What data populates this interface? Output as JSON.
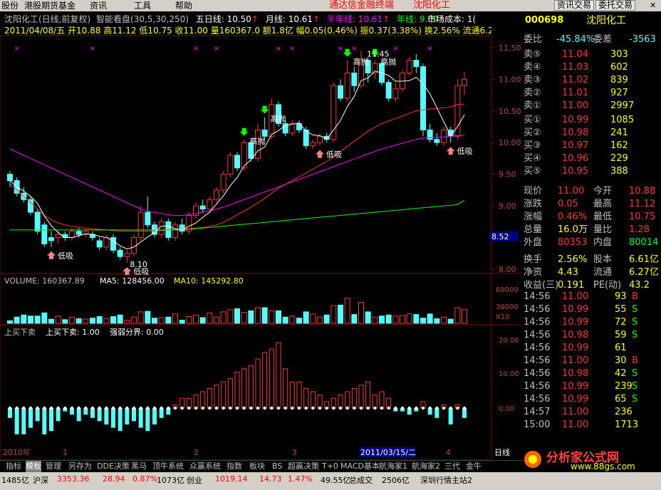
{
  "menubar": {
    "items": [
      "股份",
      "港股期货基金",
      "资讯",
      "工具",
      "帮助"
    ],
    "title": "通达信金融终端",
    "stock_name": "沈阳化工",
    "buttons": [
      "资讯交易",
      "委托交易"
    ]
  },
  "header": {
    "line1": {
      "name": "沈阳化工(日线,前复权)",
      "indicator": "智能看盘(30,5,30,250)",
      "ma5": "五日线: 10.50",
      "ma_month": "月线: 10.61",
      "ma_half": "半年线: 10.61",
      "ma_year": "年线: 9.09",
      "cost": "市场成本: 1("
    },
    "line2": "2011/04/08/五 开10.88 高11.12 低10.75 收11.00 量160367.0 额1.8亿 幅0.05(0.46%) 振0.37(3.38%) 换2.56% 流通6.27亿"
  },
  "price_axis": {
    "ticks": [
      "11.50",
      "11.00",
      "10.50",
      "10.00",
      "9.50",
      "9.00",
      "8.52",
      "8.00"
    ]
  },
  "annotations": {
    "high_sell": "高抛",
    "low_buy": "低吸",
    "peak": "11.45",
    "trough": "8.10"
  },
  "volume": {
    "label": "VOLUME: 160367.89",
    "ma5": "MA5: 128456.00",
    "ma10": "MA10: 145292.80",
    "axis": [
      "60000",
      "30000",
      "X10"
    ]
  },
  "oscillator": {
    "title": "上买下卖",
    "value": "上买下卖: 1.00",
    "boundary": "强弱分界: 0.00",
    "axis": [
      "20.00",
      "10.00",
      "0.00"
    ]
  },
  "date_axis": {
    "labels": [
      "2010年",
      "1",
      "2",
      "3",
      "2011/03/15/二",
      "4",
      "日线"
    ]
  },
  "quote": {
    "code": "000698",
    "name": "沈阳化工",
    "wei": {
      "label": "委比",
      "pct": "-45.84%",
      "diff_label": "委差",
      "diff": "-3563"
    },
    "sells": [
      {
        "l": "卖⑤",
        "p": "11.04",
        "v": "303"
      },
      {
        "l": "卖④",
        "p": "11.03",
        "v": "602"
      },
      {
        "l": "卖③",
        "p": "11.02",
        "v": "839"
      },
      {
        "l": "卖②",
        "p": "11.01",
        "v": "927"
      },
      {
        "l": "卖①",
        "p": "11.00",
        "v": "2997"
      }
    ],
    "buys": [
      {
        "l": "买①",
        "p": "10.99",
        "v": "1085"
      },
      {
        "l": "买②",
        "p": "10.98",
        "v": "241"
      },
      {
        "l": "买③",
        "p": "10.97",
        "v": "162"
      },
      {
        "l": "买④",
        "p": "10.96",
        "v": "229"
      },
      {
        "l": "买⑤",
        "p": "10.95",
        "v": "388"
      }
    ],
    "stats": [
      [
        "现价",
        "11.00",
        "今开",
        "10.88"
      ],
      [
        "涨跌",
        "0.05",
        "最高",
        "11.12"
      ],
      [
        "涨幅",
        "0.46%",
        "最低",
        "10.75"
      ],
      [
        "总量",
        "16.0万",
        "量比",
        "1.28"
      ],
      [
        "外盘",
        "80353",
        "内盘",
        "80014"
      ],
      [
        "换手",
        "2.56%",
        "股本",
        "6.61亿"
      ],
      [
        "净资",
        "4.43",
        "流通",
        "6.27亿"
      ],
      [
        "收益(三)",
        "0.191",
        "PE(动)",
        "43.2"
      ]
    ],
    "ticks": [
      [
        "14:56",
        "11.00",
        "93",
        "B"
      ],
      [
        "14:56",
        "10.99",
        "55",
        "S"
      ],
      [
        "14:56",
        "10.99",
        "72",
        "S"
      ],
      [
        "14:56",
        "10.98",
        "59",
        "S"
      ],
      [
        "14:56",
        "10.99",
        "61",
        ""
      ],
      [
        "14:56",
        "11.00",
        "30",
        "B"
      ],
      [
        "14:56",
        "10.98",
        "42",
        "S"
      ],
      [
        "14:56",
        "10.99",
        "239",
        "S"
      ],
      [
        "14:56",
        "10.99",
        "65",
        "S"
      ],
      [
        "14:57",
        "11.00",
        "236",
        ""
      ],
      [
        "15:00",
        "11.00",
        "1713",
        ""
      ]
    ]
  },
  "tabs": [
    "指标",
    "模板",
    "管理",
    "另存为",
    "DDE决策",
    "黑马",
    "顶牛系统",
    "众赢系统",
    "指数",
    "板块",
    "BS",
    "超赢决策",
    "T+0",
    "MACD基本",
    "航海家1",
    "航海家2",
    "三代",
    "金牛"
  ],
  "statusbar": {
    "items": [
      "1485亿",
      "沪深",
      "3353.36",
      "28.94",
      "0.87%",
      "1073亿",
      "创业",
      "1019.14",
      "14.73",
      "1.47%",
      "49.55亿",
      "总成交",
      "2506亿",
      "深圳行情主站2"
    ]
  },
  "watermark": {
    "text": "分析家公式网",
    "url": "www.88gs.com"
  },
  "colors": {
    "up": "#ff3232",
    "down": "#54fcfc",
    "ma5": "#ffffff",
    "ma_month": "#ff00ff",
    "ma_half": "#ff3232",
    "ma_year": "#00ff00",
    "yellow": "#ffff00"
  },
  "chart_data": {
    "type": "candlestick",
    "ylim": [
      8.0,
      11.6
    ],
    "candles": [
      [
        9.5,
        9.4,
        9.55,
        9.3
      ],
      [
        9.4,
        9.2,
        9.45,
        9.15
      ],
      [
        9.2,
        9.1,
        9.3,
        9.05
      ],
      [
        9.1,
        8.9,
        9.15,
        8.85
      ],
      [
        8.9,
        8.6,
        8.95,
        8.55
      ],
      [
        8.7,
        8.4,
        8.75,
        8.35
      ],
      [
        8.5,
        8.45,
        8.6,
        8.35
      ],
      [
        8.5,
        8.55,
        8.6,
        8.4
      ],
      [
        8.55,
        8.5,
        8.6,
        8.45
      ],
      [
        8.5,
        8.6,
        8.65,
        8.45
      ],
      [
        8.6,
        8.55,
        8.65,
        8.5
      ],
      [
        8.55,
        8.6,
        8.62,
        8.5
      ],
      [
        8.55,
        8.5,
        8.6,
        8.45
      ],
      [
        8.45,
        8.35,
        8.5,
        8.3
      ],
      [
        8.35,
        8.5,
        8.55,
        8.3
      ],
      [
        8.5,
        8.3,
        8.55,
        8.25
      ],
      [
        8.3,
        8.2,
        8.35,
        8.15
      ],
      [
        8.2,
        8.25,
        8.3,
        8.1
      ],
      [
        8.25,
        8.5,
        8.55,
        8.2
      ],
      [
        8.5,
        8.9,
        9.0,
        8.45
      ],
      [
        8.9,
        8.7,
        9.15,
        8.65
      ],
      [
        8.7,
        8.55,
        8.75,
        8.5
      ],
      [
        8.55,
        8.75,
        8.8,
        8.5
      ],
      [
        8.75,
        8.5,
        8.8,
        8.45
      ],
      [
        8.5,
        8.7,
        8.75,
        8.45
      ],
      [
        8.7,
        8.6,
        8.8,
        8.55
      ],
      [
        8.6,
        8.85,
        8.9,
        8.55
      ],
      [
        8.85,
        9.0,
        9.05,
        8.8
      ],
      [
        9.0,
        8.95,
        9.1,
        8.9
      ],
      [
        8.95,
        9.1,
        9.15,
        8.9
      ],
      [
        9.1,
        9.25,
        9.3,
        9.05
      ],
      [
        9.25,
        9.5,
        9.55,
        9.2
      ],
      [
        9.5,
        9.8,
        9.85,
        9.45
      ],
      [
        9.8,
        9.6,
        9.85,
        9.55
      ],
      [
        9.6,
        10.0,
        10.05,
        9.55
      ],
      [
        10.0,
        9.75,
        10.05,
        9.7
      ],
      [
        9.75,
        10.2,
        10.3,
        9.7
      ],
      [
        10.2,
        10.1,
        10.4,
        10.05
      ],
      [
        10.1,
        10.6,
        10.7,
        10.05
      ],
      [
        10.6,
        10.3,
        10.65,
        10.25
      ],
      [
        10.3,
        10.15,
        10.35,
        10.1
      ],
      [
        10.15,
        10.3,
        10.35,
        10.1
      ],
      [
        10.3,
        10.2,
        10.35,
        10.15
      ],
      [
        10.2,
        9.95,
        10.25,
        9.9
      ],
      [
        9.95,
        10.0,
        10.05,
        9.9
      ],
      [
        10.0,
        10.1,
        10.15,
        9.95
      ],
      [
        10.1,
        10.05,
        10.15,
        10.0
      ],
      [
        10.05,
        10.9,
        10.95,
        10.0
      ],
      [
        10.9,
        10.7,
        11.0,
        10.65
      ],
      [
        10.7,
        11.1,
        11.3,
        10.65
      ],
      [
        11.1,
        10.9,
        11.2,
        10.8
      ],
      [
        10.9,
        11.3,
        11.45,
        10.85
      ],
      [
        11.3,
        11.1,
        11.35,
        10.95
      ],
      [
        11.1,
        11.25,
        11.3,
        11.0
      ],
      [
        11.25,
        10.95,
        11.3,
        10.9
      ],
      [
        10.95,
        10.7,
        11.0,
        10.65
      ],
      [
        10.7,
        10.85,
        10.95,
        10.65
      ],
      [
        10.85,
        11.1,
        11.15,
        10.8
      ],
      [
        11.1,
        11.3,
        11.35,
        11.05
      ],
      [
        11.3,
        11.2,
        11.4,
        11.1
      ],
      [
        11.2,
        10.2,
        11.25,
        10.1
      ],
      [
        10.2,
        10.05,
        10.3,
        10.0
      ],
      [
        10.05,
        10.0,
        10.15,
        9.95
      ],
      [
        10.0,
        10.2,
        10.25,
        9.95
      ],
      [
        10.2,
        10.1,
        10.25,
        10.0
      ],
      [
        10.1,
        10.9,
        11.0,
        10.05
      ],
      [
        10.9,
        11.0,
        11.12,
        10.75
      ]
    ],
    "ma_month": [
      9.9,
      9.85,
      9.8,
      9.75,
      9.7,
      9.65,
      9.6,
      9.55,
      9.5,
      9.45,
      9.4,
      9.35,
      9.3,
      9.25,
      9.2,
      9.15,
      9.1,
      9.05,
      9.0,
      8.95,
      8.92,
      8.9,
      8.88,
      8.86,
      8.85,
      8.85,
      8.86,
      8.88,
      8.9,
      8.92,
      8.95,
      8.98,
      9.02,
      9.06,
      9.1,
      9.14,
      9.18,
      9.22,
      9.26,
      9.3,
      9.34,
      9.38,
      9.42,
      9.46,
      9.5,
      9.54,
      9.58,
      9.62,
      9.66,
      9.7,
      9.74,
      9.78,
      9.82,
      9.86,
      9.9,
      9.93,
      9.96,
      9.99,
      10.02,
      10.05,
      10.07,
      10.08,
      10.08,
      10.09,
      10.1,
      10.11,
      10.12
    ],
    "ma_half": [
      9.35,
      9.25,
      9.15,
      9.05,
      8.95,
      8.85,
      8.78,
      8.73,
      8.7,
      8.68,
      8.66,
      8.65,
      8.64,
      8.63,
      8.62,
      8.61,
      8.6,
      8.6,
      8.6,
      8.6,
      8.6,
      8.6,
      8.61,
      8.62,
      8.63,
      8.63,
      8.64,
      8.65,
      8.66,
      8.68,
      8.7,
      8.74,
      8.8,
      8.86,
      8.92,
      8.98,
      9.05,
      9.12,
      9.2,
      9.28,
      9.34,
      9.4,
      9.46,
      9.52,
      9.58,
      9.64,
      9.7,
      9.78,
      9.86,
      9.94,
      10.02,
      10.1,
      10.18,
      10.24,
      10.3,
      10.34,
      10.38,
      10.42,
      10.46,
      10.5,
      10.52,
      10.53,
      10.54,
      10.55,
      10.56,
      10.6,
      10.61
    ],
    "ma_year": [
      8.62,
      8.62,
      8.62,
      8.62,
      8.62,
      8.62,
      8.62,
      8.62,
      8.62,
      8.62,
      8.62,
      8.62,
      8.62,
      8.62,
      8.62,
      8.62,
      8.62,
      8.62,
      8.62,
      8.62,
      8.62,
      8.62,
      8.62,
      8.62,
      8.62,
      8.62,
      8.63,
      8.64,
      8.65,
      8.66,
      8.67,
      8.68,
      8.69,
      8.7,
      8.71,
      8.72,
      8.73,
      8.74,
      8.75,
      8.76,
      8.77,
      8.78,
      8.79,
      8.8,
      8.81,
      8.82,
      8.83,
      8.84,
      8.85,
      8.86,
      8.87,
      8.88,
      8.89,
      8.9,
      8.91,
      8.92,
      8.93,
      8.94,
      8.95,
      8.96,
      8.97,
      8.98,
      8.99,
      9.0,
      9.01,
      9.02,
      9.09
    ],
    "volume": [
      5,
      12,
      16,
      14,
      14,
      20,
      8,
      14,
      7,
      12,
      9,
      8,
      10,
      13,
      9,
      13,
      16,
      6,
      12,
      22,
      23,
      10,
      11,
      12,
      18,
      6,
      13,
      16,
      11,
      20,
      12,
      22,
      26,
      28,
      21,
      24,
      30,
      30,
      24,
      24,
      12,
      14,
      10,
      22,
      18,
      12,
      16,
      34,
      35,
      48,
      17,
      40,
      22,
      12,
      14,
      16,
      14,
      15,
      18,
      17,
      10,
      18,
      9,
      12,
      8,
      30,
      27
    ],
    "oscillator": [
      -3,
      -8,
      -8,
      -6,
      -4,
      -8,
      -7,
      -4,
      -1,
      -2,
      -4,
      -2,
      -3,
      -4,
      -5,
      -6,
      -7,
      -5,
      -4,
      -6,
      -7,
      -5,
      -3,
      -2,
      1,
      3,
      3,
      4,
      5,
      6,
      7,
      8,
      9,
      11,
      12,
      13,
      15,
      17,
      18,
      20,
      12,
      8,
      8,
      6,
      5,
      4,
      2,
      3,
      4,
      5,
      6,
      7,
      8,
      4,
      5,
      3,
      -1,
      -1,
      -2,
      -1,
      2,
      -2,
      -3,
      1,
      -5,
      1,
      -3
    ]
  }
}
